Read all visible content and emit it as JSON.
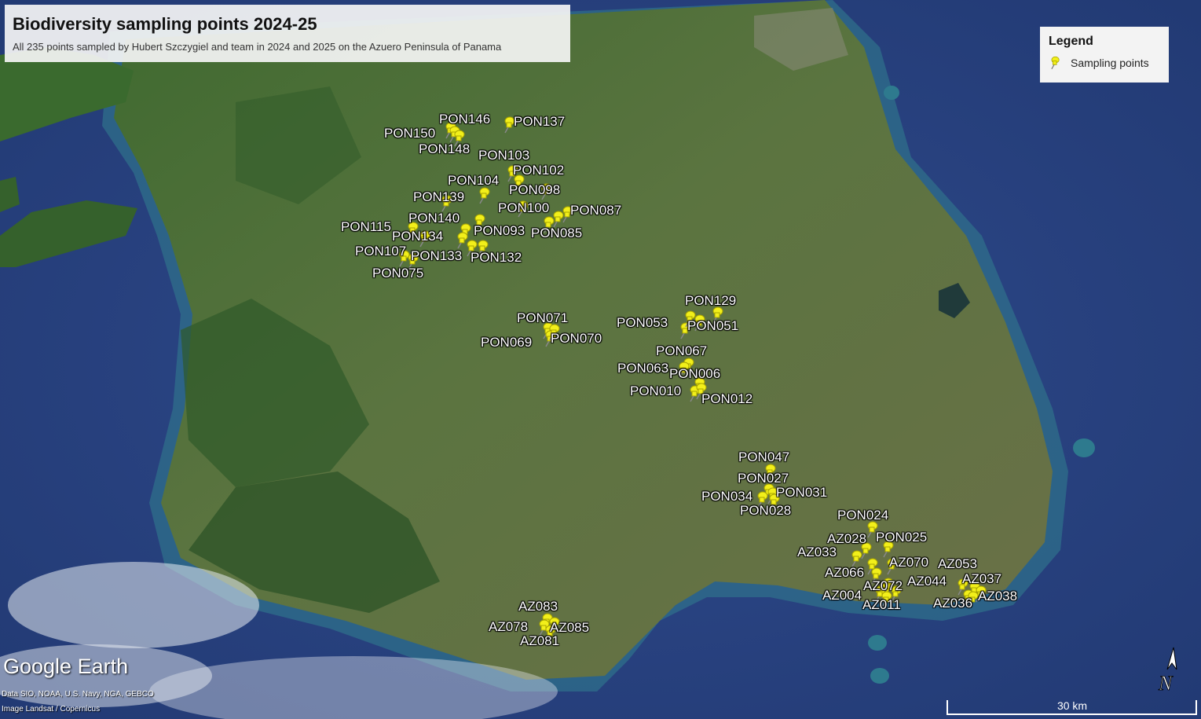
{
  "title": "Biodiversity sampling points 2024-25",
  "subtitle": "All 235 points sampled by Hubert Szczygiel and team in 2024 and 2025 on the Azuero Peninsula of Panama",
  "legend": {
    "heading": "Legend",
    "item_label": "Sampling points",
    "pin_color": "#f2ef1a"
  },
  "branding": {
    "logo": "Google Earth",
    "data_credit": "Data SIO, NOAA, U.S. Navy, NGA, GEBCO",
    "image_credit": "Image Landsat / Copernicus"
  },
  "scale": {
    "label": "30 km"
  },
  "compass": {
    "letter": "N"
  },
  "colors": {
    "ocean": "#2a3f7a",
    "land": "#4a6a34",
    "pin": "#f2ef1a"
  },
  "point_labels": [
    "PON146",
    "PON137",
    "PON150",
    "PON148",
    "PON103",
    "PON102",
    "PON104",
    "PON098",
    "PON139",
    "PON100",
    "PON087",
    "PON140",
    "PON115",
    "PON093",
    "PON085",
    "PON134",
    "PON107",
    "PON133",
    "PON132",
    "PON075",
    "PON129",
    "PON071",
    "PON053",
    "PON051",
    "PON069",
    "PON070",
    "PON067",
    "PON063",
    "PON006",
    "PON010",
    "PON012",
    "PON047",
    "PON027",
    "PON031",
    "PON034",
    "PON028",
    "PON024",
    "AZ028",
    "PON025",
    "AZ033",
    "AZ070",
    "AZ053",
    "AZ066",
    "AZ044",
    "AZ037",
    "AZ072",
    "AZ004",
    "AZ038",
    "AZ011",
    "AZ036",
    "AZ083",
    "AZ078",
    "AZ085",
    "AZ081"
  ]
}
